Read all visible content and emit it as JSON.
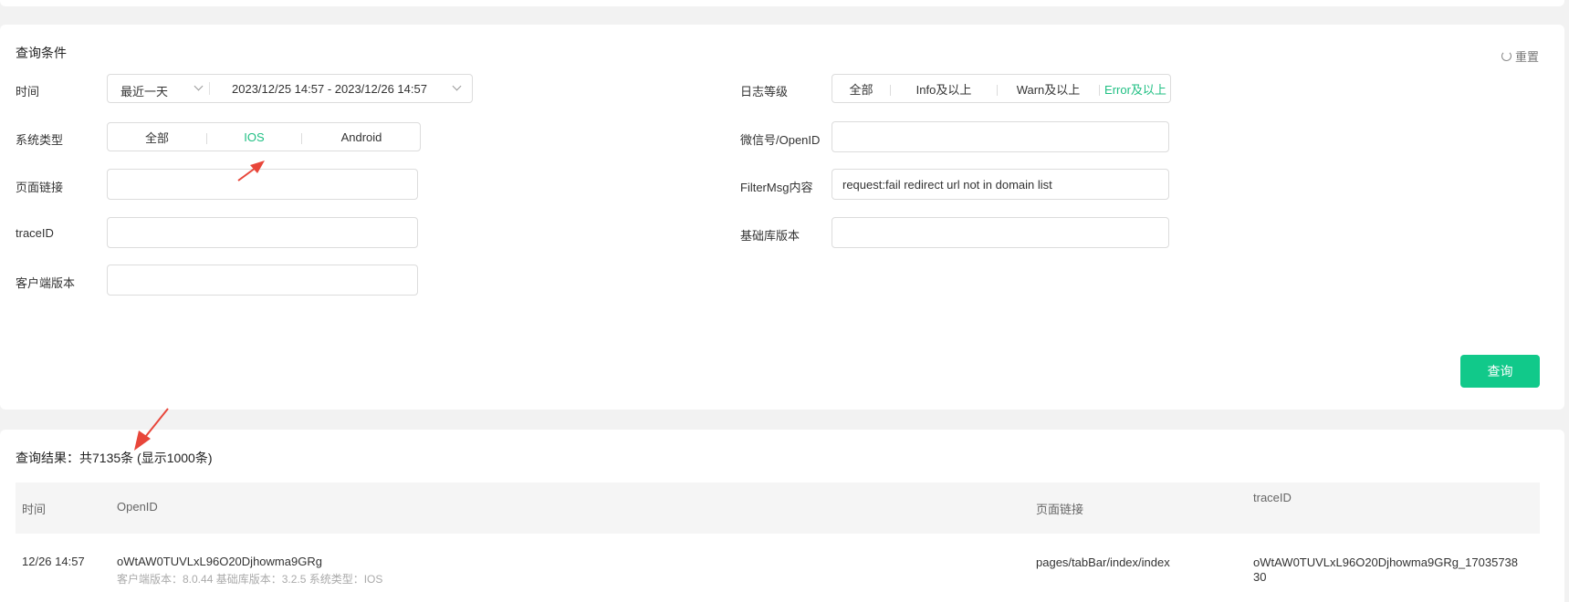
{
  "query": {
    "title": "查询条件",
    "reset_label": "重置",
    "time": {
      "label": "时间",
      "range_select": "最近一天",
      "range_value": "2023/12/25 14:57 - 2023/12/26 14:57"
    },
    "log_level": {
      "label": "日志等级",
      "options": [
        "全部",
        "Info及以上",
        "Warn及以上",
        "Error及以上"
      ],
      "active": "Error及以上"
    },
    "system_type": {
      "label": "系统类型",
      "options": [
        "全部",
        "IOS",
        "Android"
      ],
      "active": "IOS"
    },
    "wechat": {
      "label": "微信号/OpenID",
      "value": ""
    },
    "page_link": {
      "label": "页面链接",
      "value": ""
    },
    "filter_msg": {
      "label": "FilterMsg内容",
      "value": "request:fail redirect url not in domain list"
    },
    "trace_id": {
      "label": "traceID",
      "value": ""
    },
    "lib_version": {
      "label": "基础库版本",
      "value": ""
    },
    "client_version": {
      "label": "客户端版本",
      "value": ""
    },
    "submit_label": "查询"
  },
  "result": {
    "summary": "查询结果：共7135条 (显示1000条)",
    "columns": [
      "时间",
      "OpenID",
      "页面链接",
      "traceID"
    ],
    "rows": [
      {
        "time": "12/26 14:57",
        "openid": "oWtAW0TUVLxL96O20Djhowma9GRg",
        "detail": "客户端版本：8.0.44 基础库版本：3.2.5 系统类型：IOS",
        "page": "pages/tabBar/index/index",
        "trace_line1": "oWtAW0TUVLxL96O20Djhowma9GRg_17035738",
        "trace_line2": "30"
      }
    ]
  },
  "colors": {
    "accent": "#1fbf83",
    "button": "#11c98a",
    "annotation": "#e8463a"
  }
}
